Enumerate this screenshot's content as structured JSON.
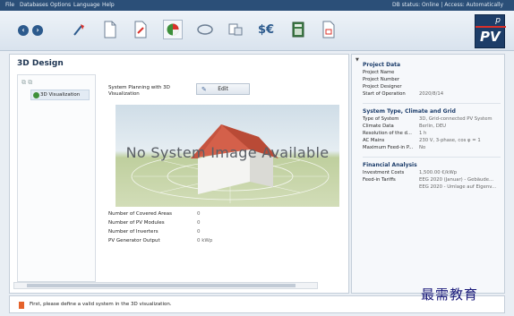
{
  "menubar": {
    "items": [
      "File",
      "Databases",
      "Options",
      "Language",
      "Help"
    ],
    "status": "DB status: Online | Access: Automatically"
  },
  "toolbar": {
    "nav": {
      "back_icon": "back-arrow-icon",
      "forward_icon": "forward-arrow-icon"
    },
    "tools": [
      "wizard-icon",
      "new-project-icon",
      "edit-document-icon",
      "3d-design-icon",
      "shading-icon",
      "database-icon",
      "currency-icon",
      "calculator-icon",
      "report-icon"
    ]
  },
  "logo": {
    "big": "PV",
    "small": "p"
  },
  "main": {
    "title": "3D Design",
    "tree_item": "3D Visualization",
    "plan_label": "System Planning with 3D Visualization",
    "edit_label": "Edit",
    "image_placeholder": "No System Image Available",
    "stats": [
      {
        "label": "Number of Covered Areas",
        "value": "0"
      },
      {
        "label": "Number of PV Modules",
        "value": "0"
      },
      {
        "label": "Number of Inverters",
        "value": "0"
      },
      {
        "label": "PV Generator Output",
        "value": "0 kWp"
      }
    ]
  },
  "right": {
    "project": {
      "title": "Project Data",
      "rows": [
        {
          "k": "Project Name",
          "v": ""
        },
        {
          "k": "Project Number",
          "v": ""
        },
        {
          "k": "Project Designer",
          "v": ""
        },
        {
          "k": "Start of Operation",
          "v": "2020/8/14"
        }
      ]
    },
    "system": {
      "title": "System Type, Climate and Grid",
      "rows": [
        {
          "k": "Type of System",
          "v": "3D, Grid-connected PV System"
        },
        {
          "k": "Climate Data",
          "v": "Berlin, DEU"
        },
        {
          "k": "Resolution of the d...",
          "v": "1 h"
        },
        {
          "k": "AC Mains",
          "v": "230 V, 3-phase, cos φ = 1"
        },
        {
          "k": "Maximum Feed-in P...",
          "v": "No"
        }
      ]
    },
    "financial": {
      "title": "Financial Analysis",
      "rows": [
        {
          "k": "Investment Costs",
          "v": "1,500.00 €/kWp"
        },
        {
          "k": "Feed-in Tariffs",
          "v": "EEG 2020 (Januar) - Gebäude..."
        },
        {
          "k": "",
          "v": "EEG 2020 - Umlage auf Eigenv..."
        }
      ]
    }
  },
  "message": "First, please define a valid system in the 3D visualization.",
  "watermark": "最需教育"
}
